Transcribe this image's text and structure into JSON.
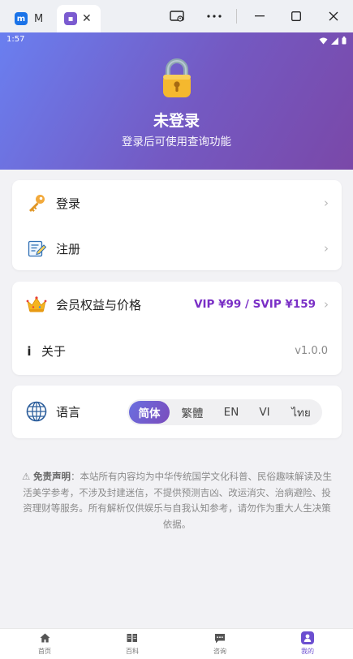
{
  "window": {
    "tabs": [
      {
        "label": "M",
        "icon": "app-m-icon"
      },
      {
        "label": "",
        "icon": "app-purple-icon",
        "close": "✕"
      }
    ]
  },
  "status": {
    "time": "1:57"
  },
  "hero": {
    "title": "未登录",
    "subtitle": "登录后可使用查询功能"
  },
  "account": {
    "login_label": "登录",
    "register_label": "注册"
  },
  "membership": {
    "label": "会员权益与价格",
    "price": "VIP ¥99 / SVIP ¥159"
  },
  "about": {
    "label": "关于",
    "version": "v1.0.0"
  },
  "language": {
    "label": "语言",
    "options": [
      "简体",
      "繁體",
      "EN",
      "VI",
      "ไทย"
    ],
    "selected": "简体"
  },
  "disclaimer": {
    "title": "免责声明",
    "text": "：本站所有内容均为中华传统国学文化科普、民俗趣味解读及生活美学参考，不涉及封建迷信，不提供预测吉凶、改运消灾、治病避险、投资理财等服务。所有解析仅供娱乐与自我认知参考，请勿作为重大人生决策依据。"
  },
  "nav": {
    "items": [
      {
        "label": "首页"
      },
      {
        "label": "百科"
      },
      {
        "label": "咨询"
      },
      {
        "label": "我的"
      }
    ],
    "active": "我的"
  },
  "colors": {
    "accent": "#7459c2",
    "vip_text": "#7a2fc6",
    "hero_start": "#6a7ff0",
    "hero_end": "#7a48a8"
  }
}
